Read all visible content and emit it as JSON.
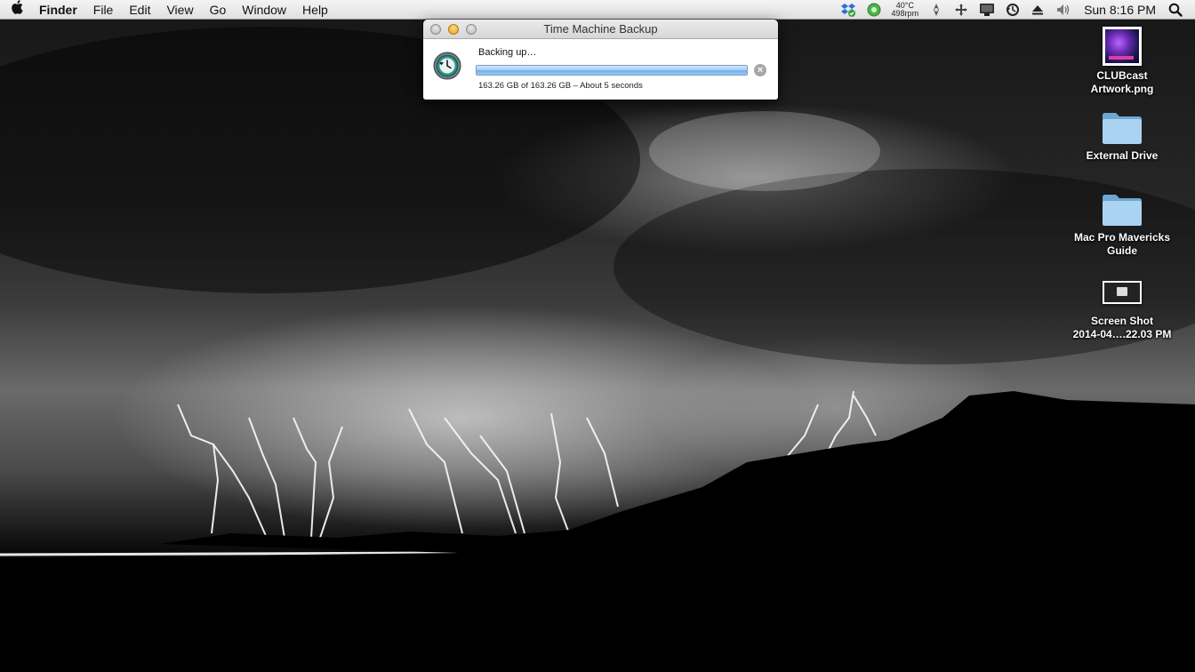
{
  "menubar": {
    "apple_icon": "apple-logo-icon",
    "app_name": "Finder",
    "items": [
      {
        "label": "File"
      },
      {
        "label": "Edit"
      },
      {
        "label": "View"
      },
      {
        "label": "Go"
      },
      {
        "label": "Window"
      },
      {
        "label": "Help"
      }
    ],
    "status": {
      "temperature": "40°C",
      "fan_speed": "498rpm",
      "clock": "Sun 8:16 PM",
      "icons": [
        "dropbox-icon",
        "green-status-icon",
        "sensor-icon",
        "move-icon",
        "display-icon",
        "time-machine-icon",
        "eject-icon",
        "volume-icon",
        "spotlight-icon"
      ]
    }
  },
  "time_machine": {
    "title": "Time Machine Backup",
    "status": "Backing up…",
    "detail": "163.26 GB of 163.26 GB – About 5 seconds",
    "progress_fraction": 1.0,
    "stop_symbol": "×"
  },
  "desktop": {
    "icons": [
      {
        "label": "CLUBcast\nArtwork.png",
        "kind": "image-file-icon"
      },
      {
        "label": "External Drive",
        "kind": "folder-icon"
      },
      {
        "label": "Mac Pro Mavericks\nGuide",
        "kind": "folder-icon"
      },
      {
        "label": "Screen Shot\n2014-04….22.03 PM",
        "kind": "screenshot-file-icon"
      }
    ]
  },
  "colors": {
    "menubar_bg": "#e8e8e8",
    "progress_blue": "#6fb0ef",
    "folder_blue": "#8fc3e8",
    "minimize_yellow": "#e6a019"
  }
}
